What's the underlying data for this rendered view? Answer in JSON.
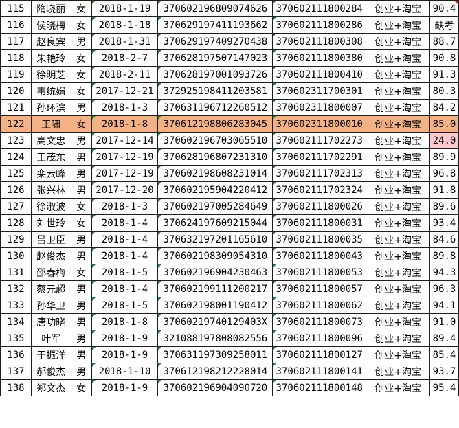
{
  "rows": [
    {
      "no": "115",
      "name": "隋晓丽",
      "sex": "女",
      "date": "2018-1-19",
      "id": "370602196809074626",
      "code": "370602111800284",
      "major": "创业+淘宝",
      "score": "90.4"
    },
    {
      "no": "116",
      "name": "侯晓梅",
      "sex": "女",
      "date": "2018-1-18",
      "id": "370629197411193662",
      "code": "370602111800286",
      "major": "创业+淘宝",
      "score": "缺考"
    },
    {
      "no": "117",
      "name": "赵良宾",
      "sex": "男",
      "date": "2018-1-31",
      "id": "370629197409270438",
      "code": "370602111800308",
      "major": "创业+淘宝",
      "score": "88.7"
    },
    {
      "no": "118",
      "name": "朱艳玲",
      "sex": "女",
      "date": "2018-2-7",
      "id": "370628197507147023",
      "code": "370602111800380",
      "major": "创业+淘宝",
      "score": "90.8"
    },
    {
      "no": "119",
      "name": "徐明芝",
      "sex": "女",
      "date": "2018-2-11",
      "id": "370628197001093726",
      "code": "370602111800410",
      "major": "创业+淘宝",
      "score": "91.3"
    },
    {
      "no": "120",
      "name": "韦统娟",
      "sex": "女",
      "date": "2017-12-21",
      "id": "372925198411203581",
      "code": "370602311700301",
      "major": "创业+淘宝",
      "score": "80.3"
    },
    {
      "no": "121",
      "name": "孙环滨",
      "sex": "男",
      "date": "2018-1-3",
      "id": "370631196712260512",
      "code": "370602311800007",
      "major": "创业+淘宝",
      "score": "84.2"
    },
    {
      "no": "122",
      "name": "王啸",
      "sex": "女",
      "date": "2018-1-8",
      "id": "370612198806283045",
      "code": "370602311800010",
      "major": "创业+淘宝",
      "score": "85.0"
    },
    {
      "no": "123",
      "name": "高文忠",
      "sex": "男",
      "date": "2017-12-14",
      "id": "370602196703065510",
      "code": "370602111702273",
      "major": "创业+淘宝",
      "score": "24.0"
    },
    {
      "no": "124",
      "name": "王茂东",
      "sex": "男",
      "date": "2017-12-19",
      "id": "370628196807231310",
      "code": "370602111702291",
      "major": "创业+淘宝",
      "score": "89.9"
    },
    {
      "no": "125",
      "name": "栾云峰",
      "sex": "男",
      "date": "2017-12-19",
      "id": "370602198608231014",
      "code": "370602111702313",
      "major": "创业+淘宝",
      "score": "96.8"
    },
    {
      "no": "126",
      "name": "张兴林",
      "sex": "男",
      "date": "2017-12-20",
      "id": "370602195904220412",
      "code": "370602111702324",
      "major": "创业+淘宝",
      "score": "91.8"
    },
    {
      "no": "127",
      "name": "徐淑波",
      "sex": "女",
      "date": "2018-1-3",
      "id": "370602197005284649",
      "code": "370602111800026",
      "major": "创业+淘宝",
      "score": "89.6"
    },
    {
      "no": "128",
      "name": "刘世玲",
      "sex": "女",
      "date": "2018-1-4",
      "id": "370624197609215044",
      "code": "370602111800031",
      "major": "创业+淘宝",
      "score": "93.4"
    },
    {
      "no": "129",
      "name": "吕卫臣",
      "sex": "男",
      "date": "2018-1-4",
      "id": "370632197201165610",
      "code": "370602111800035",
      "major": "创业+淘宝",
      "score": "84.6"
    },
    {
      "no": "130",
      "name": "赵俊杰",
      "sex": "男",
      "date": "2018-1-4",
      "id": "370602198309054310",
      "code": "370602111800043",
      "major": "创业+淘宝",
      "score": "89.8"
    },
    {
      "no": "131",
      "name": "邵春梅",
      "sex": "女",
      "date": "2018-1-5",
      "id": "370602196904230463",
      "code": "370602111800053",
      "major": "创业+淘宝",
      "score": "94.3"
    },
    {
      "no": "132",
      "name": "蔡元超",
      "sex": "男",
      "date": "2018-1-4",
      "id": "370602199111200217",
      "code": "370602111800057",
      "major": "创业+淘宝",
      "score": "96.3"
    },
    {
      "no": "133",
      "name": "孙华卫",
      "sex": "男",
      "date": "2018-1-5",
      "id": "370602198001190412",
      "code": "370602111800062",
      "major": "创业+淘宝",
      "score": "94.1"
    },
    {
      "no": "134",
      "name": "唐功晓",
      "sex": "男",
      "date": "2018-1-8",
      "id": "37060219740129403X",
      "code": "370602111800073",
      "major": "创业+淘宝",
      "score": "91.0"
    },
    {
      "no": "135",
      "name": "叶军",
      "sex": "男",
      "date": "2018-1-9",
      "id": "321088197808082556",
      "code": "370602111800096",
      "major": "创业+淘宝",
      "score": "89.4"
    },
    {
      "no": "136",
      "name": "于振洋",
      "sex": "男",
      "date": "2018-1-9",
      "id": "370631197309258011",
      "code": "370602111800127",
      "major": "创业+淘宝",
      "score": "85.4"
    },
    {
      "no": "137",
      "name": "郝俊杰",
      "sex": "男",
      "date": "2018-1-10",
      "id": "370612198212228014",
      "code": "370602111800141",
      "major": "创业+淘宝",
      "score": "93.7"
    },
    {
      "no": "138",
      "name": "郑文杰",
      "sex": "女",
      "date": "2018-1-9",
      "id": "370602196904090720",
      "code": "370602111800148",
      "major": "创业+淘宝",
      "score": "95.4"
    }
  ],
  "highlight_row": "122",
  "colors": {
    "row_highlight": "#f4b183",
    "bad_score_fill": "#ffc7ce",
    "bad_score_text": "#9c0006",
    "comment_marker": "#e02020",
    "text_marker": "#1a8a32"
  }
}
